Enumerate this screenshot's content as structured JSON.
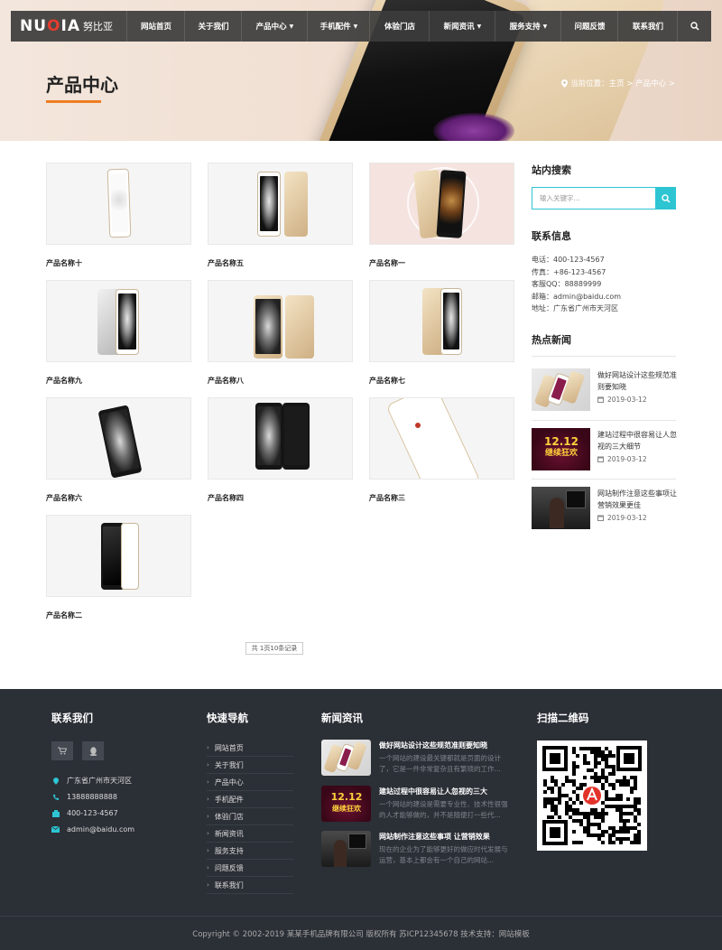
{
  "brand": {
    "logo_en_pre": "NU",
    "logo_en_o": "O",
    "logo_en_post": "IA",
    "logo_cn": "努比亚"
  },
  "nav": {
    "items": [
      {
        "label": "网站首页",
        "has_dropdown": false
      },
      {
        "label": "关于我们",
        "has_dropdown": false
      },
      {
        "label": "产品中心",
        "has_dropdown": true
      },
      {
        "label": "手机配件",
        "has_dropdown": true
      },
      {
        "label": "体验门店",
        "has_dropdown": false
      },
      {
        "label": "新闻资讯",
        "has_dropdown": true
      },
      {
        "label": "服务支持",
        "has_dropdown": true
      },
      {
        "label": "问题反馈",
        "has_dropdown": false
      },
      {
        "label": "联系我们",
        "has_dropdown": false
      }
    ],
    "search_icon": "search-icon"
  },
  "banner": {
    "title": "产品中心",
    "breadcrumb": "当前位置：主页 > 产品中心 >",
    "accent_color": "#ef7d22"
  },
  "products": [
    {
      "name": "产品名称十"
    },
    {
      "name": "产品名称五"
    },
    {
      "name": "产品名称一"
    },
    {
      "name": "产品名称九"
    },
    {
      "name": "产品名称八"
    },
    {
      "name": "产品名称七"
    },
    {
      "name": "产品名称六"
    },
    {
      "name": "产品名称四"
    },
    {
      "name": "产品名称三"
    },
    {
      "name": "产品名称二"
    }
  ],
  "pagination": {
    "label": "共 1页10条记录"
  },
  "sidebar": {
    "search": {
      "title": "站内搜索",
      "placeholder": "输入关键字..."
    },
    "contact": {
      "title": "联系信息",
      "lines": [
        "电话：400-123-4567",
        "传真：+86-123-4567",
        "客服QQ：88889999",
        "邮箱：admin@baidu.com",
        "地址：广东省广州市天河区"
      ]
    },
    "hot_news": {
      "title": "热点新闻",
      "items": [
        {
          "title": "做好网站设计这些规范准则要知晓",
          "date": "2019-03-12"
        },
        {
          "title": "建站过程中很容易让人忽视的三大细节",
          "date": "2019-03-12"
        },
        {
          "title": "网站制作注意这些事项让营销效果更佳",
          "date": "2019-03-12"
        }
      ]
    },
    "accent_color": "#2ec5d3"
  },
  "footer": {
    "contact": {
      "title": "联系我们",
      "address": "广东省广州市天河区",
      "mobile": "13888888888",
      "phone": "400-123-4567",
      "email": "admin@baidu.com"
    },
    "quick_nav": {
      "title": "快速导航",
      "items": [
        "网站首页",
        "关于我们",
        "产品中心",
        "手机配件",
        "体验门店",
        "新闻资讯",
        "服务支持",
        "问题反馈",
        "联系我们"
      ]
    },
    "news": {
      "title": "新闻资讯",
      "items": [
        {
          "title": "做好网站设计这些规范准则要知晓",
          "desc": "一个网站的建设最关键都就是页面的设计了，它是一件非常复杂且有繁琐的工作..."
        },
        {
          "title": "建站过程中很容易让人忽视的三大",
          "desc": "一个网站的建设是需要专业性、技术性很强的人才能够做的，并不是随便打一些代..."
        },
        {
          "title": "网站制作注意这些事项 让营销效果",
          "desc": "现在的企业为了能够更好的做应时代发展与运营，基本上都会有一个自己的网站..."
        }
      ]
    },
    "qr": {
      "title": "扫描二维码"
    },
    "copyright": "Copyright © 2002-2019 某某手机品牌有限公司 版权所有    苏ICP12345678   技术支持：网站模板",
    "bg_color": "#2b2f36"
  }
}
